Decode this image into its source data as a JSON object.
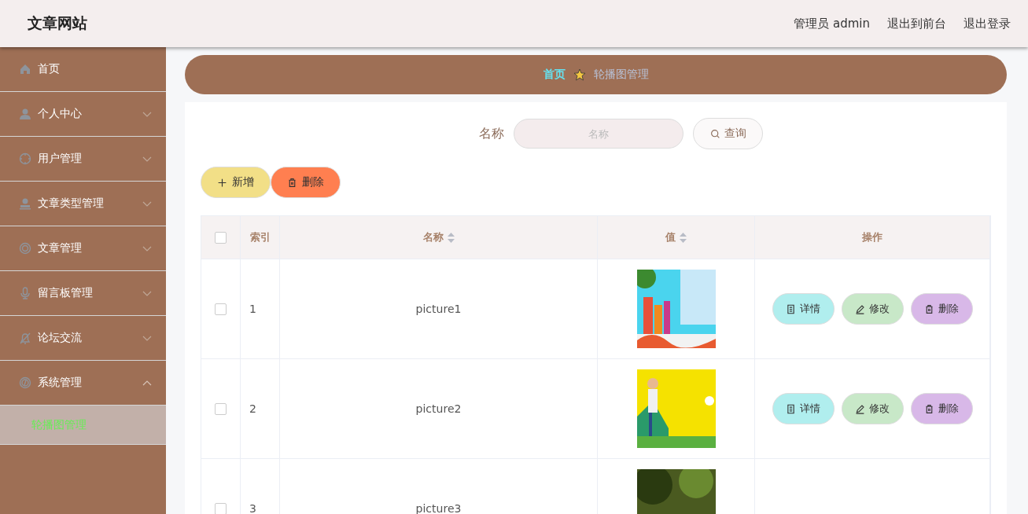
{
  "header": {
    "title": "文章网站",
    "links": [
      {
        "label": "管理员 admin"
      },
      {
        "label": "退出到前台"
      },
      {
        "label": "退出登录"
      }
    ]
  },
  "sidebar": {
    "items": [
      {
        "label": "首页",
        "expandable": false
      },
      {
        "label": "个人中心",
        "expandable": true,
        "expanded": false
      },
      {
        "label": "用户管理",
        "expandable": true,
        "expanded": false
      },
      {
        "label": "文章类型管理",
        "expandable": true,
        "expanded": false
      },
      {
        "label": "文章管理",
        "expandable": true,
        "expanded": false
      },
      {
        "label": "留言板管理",
        "expandable": true,
        "expanded": false
      },
      {
        "label": "论坛交流",
        "expandable": true,
        "expanded": false
      },
      {
        "label": "系统管理",
        "expandable": true,
        "expanded": true,
        "children": [
          {
            "label": "轮播图管理",
            "selected": true
          }
        ]
      }
    ]
  },
  "breadcrumb": [
    {
      "label": "首页"
    },
    {
      "label": "轮播图管理"
    }
  ],
  "search": {
    "label": "名称",
    "placeholder": "名称",
    "button": "查询"
  },
  "toolbar": [
    {
      "kind": "add",
      "label": "新增"
    },
    {
      "kind": "delete",
      "label": "删除"
    }
  ],
  "table": {
    "select_all_checked": false,
    "columns": [
      {
        "label": "索引",
        "sortable": false
      },
      {
        "label": "名称",
        "sortable": true
      },
      {
        "label": "值",
        "sortable": true
      },
      {
        "label": "操作",
        "sortable": false
      }
    ],
    "rows": [
      {
        "checked": false,
        "index": "1",
        "name": "picture1",
        "value": {
          "kind": "picture"
        },
        "actions": [
          {
            "kind": "detail",
            "label": "详情"
          },
          {
            "kind": "edit",
            "label": "修改"
          },
          {
            "kind": "delete",
            "label": "删除"
          }
        ]
      },
      {
        "checked": false,
        "index": "2",
        "name": "picture2",
        "value": {
          "kind": "picture"
        },
        "actions": [
          {
            "kind": "detail",
            "label": "详情"
          },
          {
            "kind": "edit",
            "label": "修改"
          },
          {
            "kind": "delete",
            "label": "删除"
          }
        ]
      },
      {
        "checked": false,
        "index": "3",
        "name": "picture3",
        "value": {
          "kind": "picture"
        }
      }
    ]
  }
}
